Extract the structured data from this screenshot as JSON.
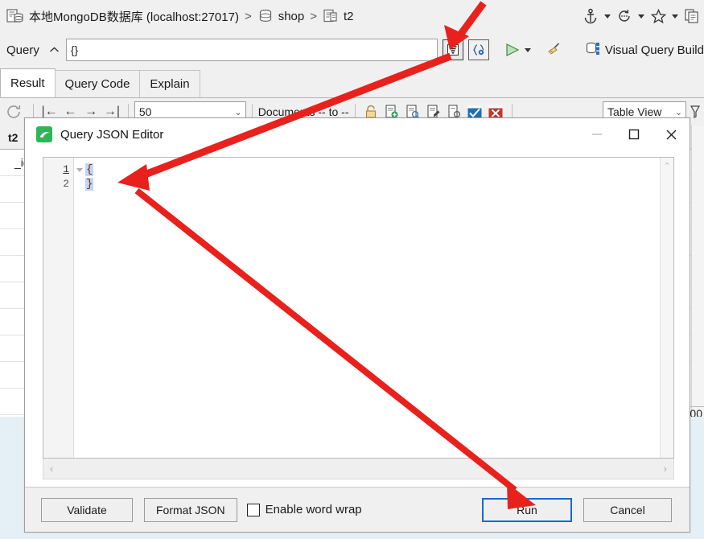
{
  "window": {
    "breadcrumb": {
      "connection": "本地MongoDB数据库 (localhost:27017)",
      "database": "shop",
      "collection": "t2",
      "separator": ">"
    },
    "top_right_icons": [
      "anchor-icon",
      "history-icon",
      "star-icon",
      "copy-icon"
    ]
  },
  "query_bar": {
    "label": "Query",
    "collapse_chevron": "⌃",
    "input_value": "{}",
    "json_editor_button": "json-editor-icon",
    "query_settings_button": "query-settings-icon",
    "run_button": "run-play-icon",
    "run_dropdown": "chevron-down-icon",
    "clear_button": "broom-icon",
    "visual_query_builder": "Visual Query Build"
  },
  "tabs": [
    {
      "label": "Result",
      "active": true
    },
    {
      "label": "Query Code",
      "active": false
    },
    {
      "label": "Explain",
      "active": false
    }
  ],
  "result_toolbar": {
    "refresh": "refresh-icon",
    "nav": [
      "first-icon",
      "prev-icon",
      "next-icon",
      "last-icon"
    ],
    "page_size": "50",
    "documents_text": "Documents -- to --",
    "lock": "lock-icon",
    "doc_actions": [
      "add-document-icon",
      "view-document-icon",
      "edit-document-icon",
      "find-document-icon"
    ],
    "confirm": "confirm-check-icon",
    "reject": "reject-x-icon",
    "view_mode": "Table View"
  },
  "grid": {
    "header": "t2",
    "first_cell": "_id",
    "rows": [
      "",
      "",
      "",
      "",
      "",
      "",
      "",
      "",
      ""
    ],
    "bottom_value": ".00"
  },
  "dialog": {
    "title": "Query JSON Editor",
    "app_icon": "mongodb-leaf-icon",
    "minimize": "minimize-icon",
    "maximize": "maximize-icon",
    "close": "close-icon",
    "editor": {
      "line_numbers": [
        "1",
        "2"
      ],
      "lines": [
        "{",
        "}"
      ],
      "fold_marker": "fold-triangle-icon",
      "v_scroll_up": "⌃",
      "h_scroll_left": "‹",
      "h_scroll_right": "›"
    },
    "buttons": {
      "validate": "Validate",
      "format_json": "Format JSON",
      "word_wrap_label": "Enable word wrap",
      "word_wrap_checked": false,
      "run": "Run",
      "cancel": "Cancel"
    }
  },
  "annotations": {
    "arrow_color": "#e8211c",
    "arrow_count": 2,
    "arrow_1_target": "json-editor-icon",
    "arrow_2_target": "run-button"
  }
}
